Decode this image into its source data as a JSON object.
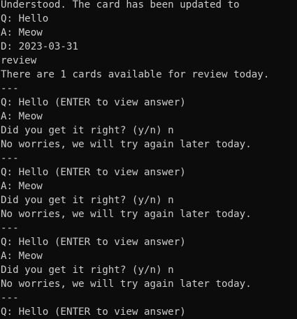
{
  "colors": {
    "background": "#0c0c0c",
    "text": "#cccccc"
  },
  "terminal": {
    "lines": [
      "Understood. The card has been updated to",
      "Q: Hello",
      "A: Meow",
      "D: 2023-03-31",
      "review",
      "There are 1 cards available for review today.",
      "---",
      "Q: Hello (ENTER to view answer)",
      "A: Meow",
      "Did you get it right? (y/n) n",
      "No worries, we will try again later today.",
      "---",
      "Q: Hello (ENTER to view answer)",
      "A: Meow",
      "Did you get it right? (y/n) n",
      "No worries, we will try again later today.",
      "---",
      "Q: Hello (ENTER to view answer)",
      "A: Meow",
      "Did you get it right? (y/n) n",
      "No worries, we will try again later today.",
      "---",
      "Q: Hello (ENTER to view answer)"
    ]
  }
}
